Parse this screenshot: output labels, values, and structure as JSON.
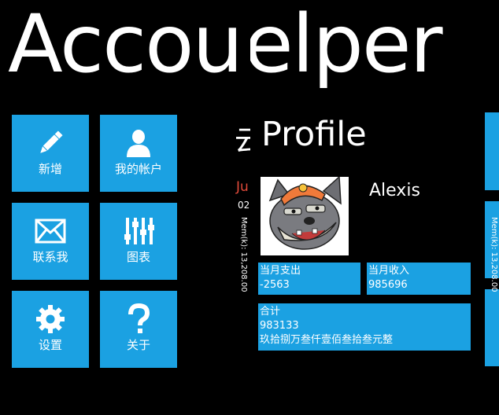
{
  "app": {
    "title_left": "Accou",
    "title_right": "elper"
  },
  "tiles": [
    {
      "label": "新增",
      "icon": "pencil-icon"
    },
    {
      "label": "我的帐户",
      "icon": "person-icon"
    },
    {
      "label": "联系我",
      "icon": "mail-icon"
    },
    {
      "label": "图表",
      "icon": "sliders-icon"
    },
    {
      "label": "设置",
      "icon": "gear-icon"
    },
    {
      "label": "关于",
      "icon": "question-icon"
    }
  ],
  "peek": {
    "title": "云",
    "red": "Ju",
    "sub": "02",
    "memory": "Mem(k): 13,208.00"
  },
  "profile": {
    "heading": "Profile",
    "username": "Alexis",
    "avatar_icon": "wolf-avatar-icon",
    "month_expense_label": "当月支出",
    "month_expense_value": "-2563",
    "month_income_label": "当月收入",
    "month_income_value": "985696",
    "total_label": "合计",
    "total_value": "983133",
    "total_words": "玖拾捌万叁仟壹佰叁拾叁元整"
  },
  "edge": {
    "memory": "Mem(k): 13,208.00"
  },
  "colors": {
    "accent": "#1ba1e2",
    "background": "#000000",
    "red": "#e04a3a"
  }
}
